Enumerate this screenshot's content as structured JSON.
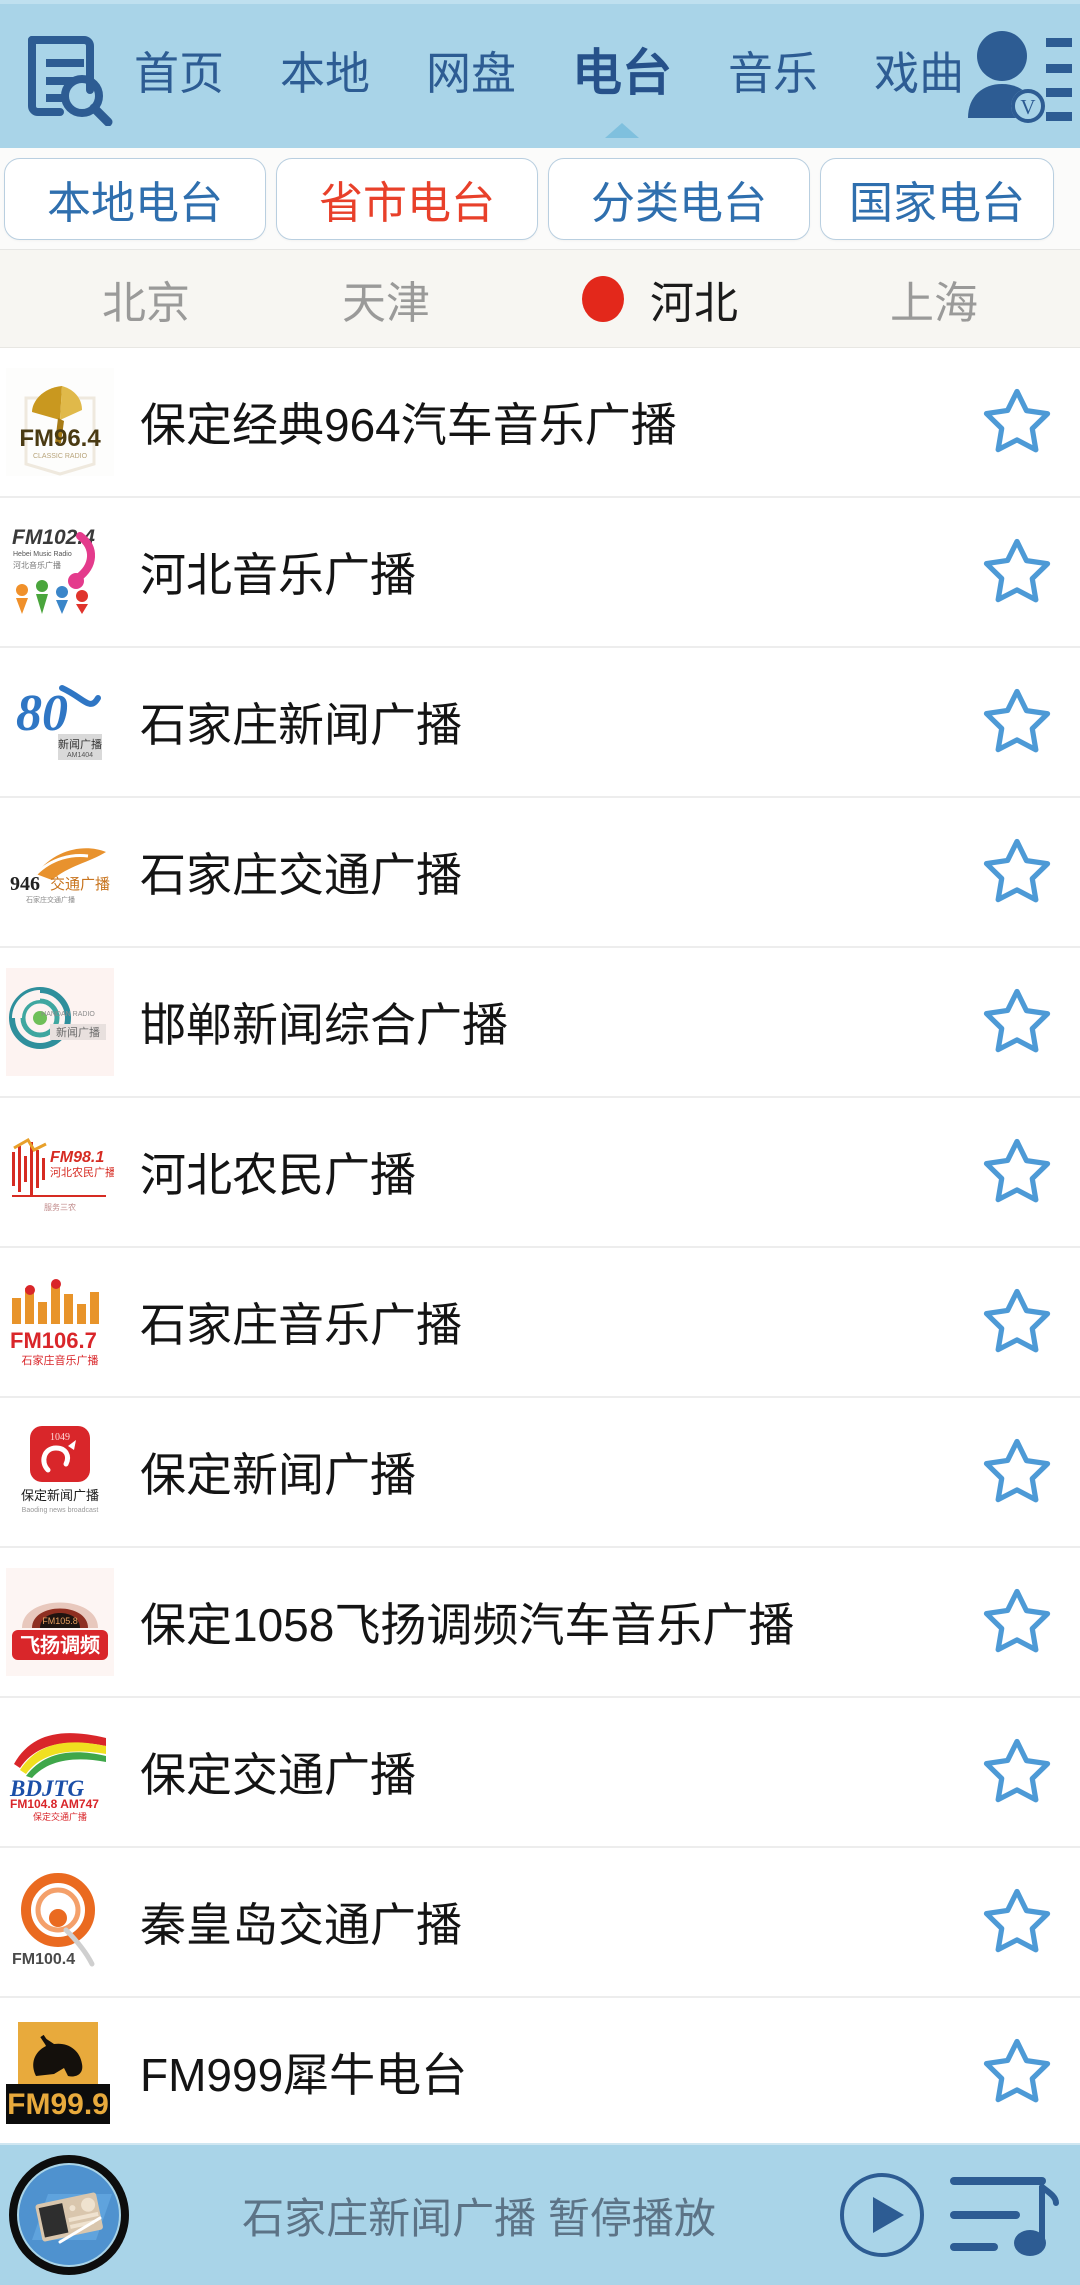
{
  "header": {
    "logo_icon": "document-search-icon",
    "nav_tabs": [
      {
        "label": "首页",
        "active": false
      },
      {
        "label": "本地",
        "active": false
      },
      {
        "label": "网盘",
        "active": false
      },
      {
        "label": "电台",
        "active": true
      },
      {
        "label": "音乐",
        "active": false
      },
      {
        "label": "戏曲",
        "active": false
      }
    ],
    "user_icon": "user-verified-icon",
    "bg_color": "#a9d4e8",
    "text_color": "#2d5c93"
  },
  "filter_chips": [
    {
      "label": "本地电台",
      "active": false
    },
    {
      "label": "省市电台",
      "active": true
    },
    {
      "label": "分类电台",
      "active": false
    },
    {
      "label": "国家电台",
      "active": false
    }
  ],
  "chip_active_color": "#e8402a",
  "cities": [
    {
      "label": "北京",
      "selected": false
    },
    {
      "label": "天津",
      "selected": false
    },
    {
      "label": "河北",
      "selected": true
    },
    {
      "label": "上海",
      "selected": false
    }
  ],
  "city_marker_color": "#e3281b",
  "stations": [
    {
      "name": "保定经典964汽车音乐广播",
      "logo": "fm964-gramophone-logo",
      "favorited": false
    },
    {
      "name": "河北音乐广播",
      "logo": "fm1024-hebei-music-logo",
      "favorited": false
    },
    {
      "name": "石家庄新闻广播",
      "logo": "shijiazhuang-news-80-logo",
      "favorited": false
    },
    {
      "name": "石家庄交通广播",
      "logo": "946-traffic-wing-logo",
      "favorited": false
    },
    {
      "name": "邯郸新闻综合广播",
      "logo": "handan-news-circle-logo",
      "favorited": false
    },
    {
      "name": "河北农民广播",
      "logo": "fm981-farmer-logo",
      "favorited": false
    },
    {
      "name": "石家庄音乐广播",
      "logo": "fm1067-music-logo",
      "favorited": false
    },
    {
      "name": "保定新闻广播",
      "logo": "baoding-news-red-logo",
      "favorited": false
    },
    {
      "name": "保定1058飞扬调频汽车音乐广播",
      "logo": "fm1058-feiyang-logo",
      "favorited": false
    },
    {
      "name": "保定交通广播",
      "logo": "bdjtg-fm1048-am747-logo",
      "favorited": false
    },
    {
      "name": "秦皇岛交通广播",
      "logo": "fm1004-qinhuangdao-logo",
      "favorited": false
    },
    {
      "name": "FM999犀牛电台",
      "logo": "fm999-rhino-logo",
      "favorited": false
    }
  ],
  "favorite_icon": "star-outline-icon",
  "favorite_color": "#4d9ad6",
  "player": {
    "album_icon": "radio-receiver-icon",
    "status_text": "石家庄新闻广播 暂停播放",
    "play_icon": "play-circle-icon",
    "playlist_icon": "playlist-music-icon",
    "bg_color": "#a9d4e8"
  }
}
